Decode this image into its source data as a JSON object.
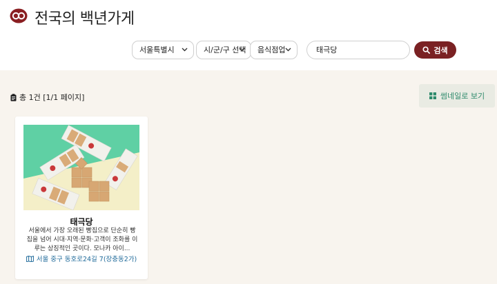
{
  "site": {
    "title": "전국의 백년가게"
  },
  "filters": {
    "region": "서울특별시",
    "district": "시/군/구 선택",
    "category": "음식점업"
  },
  "search": {
    "value": "태극당",
    "button_label": "검색"
  },
  "results": {
    "count_label": "총 1건 [1/1 페이지]",
    "view_toggle_label": "썸네일로 보기"
  },
  "stores": [
    {
      "name": "태극당",
      "description": "서울에서 가장 오래된 빵집으로 단순히 빵집을 넘어 시대·지역·문화·고객이 조화를 이루는 상징적인 곳이다. 모나카 아이...",
      "address": "서울 중구 동호로24길 7(장충동2가)"
    }
  ],
  "colors": {
    "accent": "#7a2123",
    "background": "#f8f4ee",
    "link": "#1f6a9a",
    "toggle_text": "#2e8a6b"
  }
}
